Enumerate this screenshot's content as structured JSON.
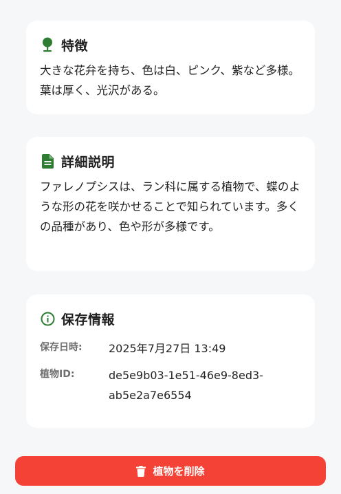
{
  "colors": {
    "accent_green": "#2e7d32",
    "danger_red": "#f44336",
    "card_background": "#ffffff",
    "page_background": "#f6f7f9"
  },
  "features": {
    "icon": "tree-icon",
    "title": "特徴",
    "text": "大きな花弁を持ち、色は白、ピンク、紫など多様。葉は厚く、光沢がある。"
  },
  "detail": {
    "icon": "document-icon",
    "title": "詳細説明",
    "text": "ファレノプシスは、ラン科に属する植物で、蝶のような形の花を咲かせることで知られています。多くの品種があり、色や形が多様です。"
  },
  "save_info": {
    "icon": "info-icon",
    "title": "保存情報",
    "rows": [
      {
        "label": "保存日時:",
        "value": "2025年7月27日 13:49"
      },
      {
        "label": "植物ID:",
        "value": "de5e9b03-1e51-46e9-8ed3-ab5e2a7e6554"
      }
    ]
  },
  "delete_button": {
    "icon": "trash-icon",
    "label": "植物を削除"
  }
}
